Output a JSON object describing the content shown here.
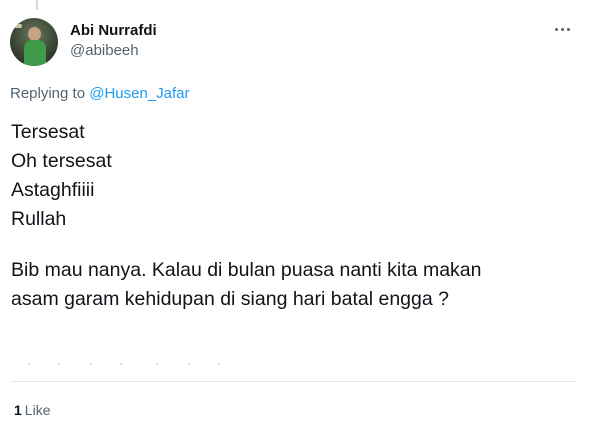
{
  "tweet": {
    "author": {
      "display_name": "Abi Nurrafdi",
      "handle": "@abibeeh"
    },
    "more_icon": "more-horizontal-icon",
    "reply_prefix": "Replying to",
    "reply_mention": "@Husen_Jafar",
    "text_lines": [
      "Tersesat",
      "Oh tersesat",
      "Astaghfiiii",
      "Rullah"
    ],
    "paragraph_lines": [
      "Bib mau nanya. Kalau di bulan puasa nanti kita makan",
      "asam garam kehidupan di siang hari batal engga ?"
    ],
    "likes": {
      "count": "1",
      "label": "Like"
    }
  },
  "colors": {
    "text": "#0f1419",
    "secondary": "#536471",
    "link": "#1d9bf0",
    "divider": "#e1e8ed"
  }
}
